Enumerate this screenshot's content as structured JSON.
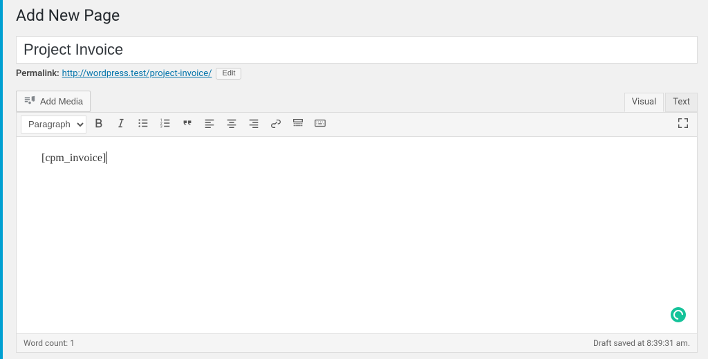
{
  "header": {
    "title": "Add New Page"
  },
  "title_field": {
    "value": "Project Invoice"
  },
  "permalink": {
    "label": "Permalink:",
    "url_text": "http://wordpress.test/project-invoice/",
    "edit_label": "Edit"
  },
  "media_button": {
    "label": "Add Media"
  },
  "editor_tabs": {
    "visual": "Visual",
    "text": "Text",
    "active": "visual"
  },
  "toolbar": {
    "format_select": "Paragraph"
  },
  "content": {
    "body": "[cpm_invoice]"
  },
  "statusbar": {
    "wordcount_label": "Word count:",
    "wordcount_value": "1",
    "draft_saved": "Draft saved at 8:39:31 am."
  }
}
